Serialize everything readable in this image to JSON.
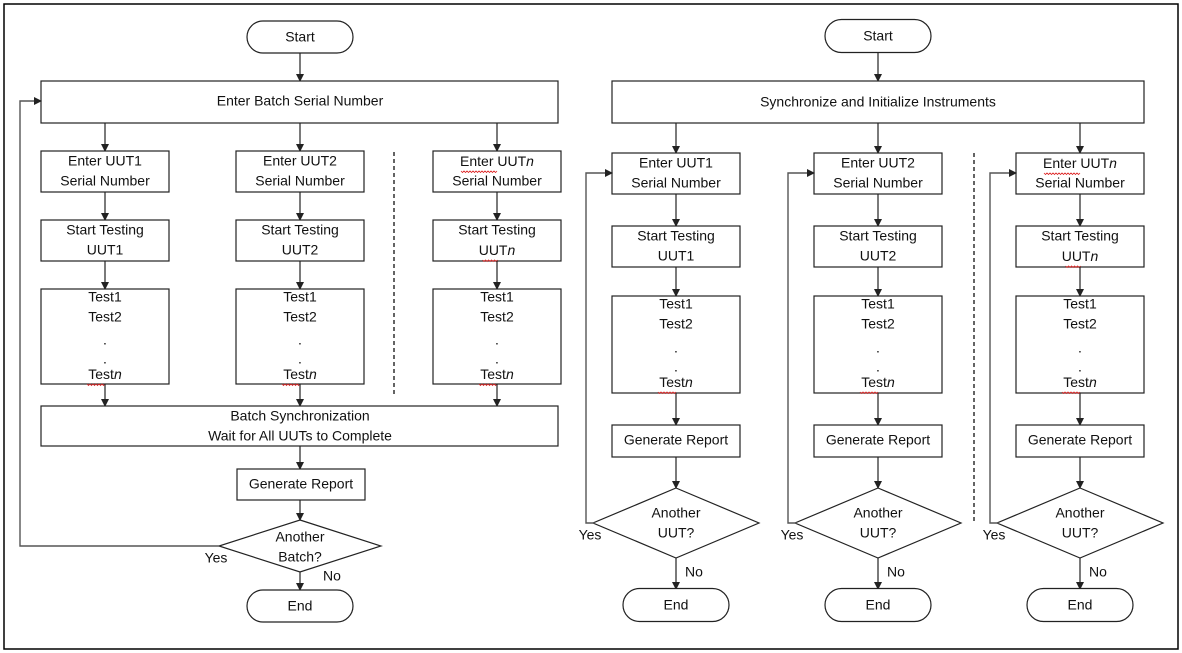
{
  "diagram": {
    "left": {
      "start": "Start",
      "batch_serial": "Enter Batch Serial Number",
      "columns": [
        {
          "enter": [
            "Enter UUT1",
            "Serial Number"
          ],
          "start_testing": [
            "Start Testing",
            "UUT1"
          ],
          "tests": [
            "Test1",
            "Test2",
            ".",
            ".",
            "Testn"
          ]
        },
        {
          "enter": [
            "Enter UUT2",
            "Serial Number"
          ],
          "start_testing": [
            "Start Testing",
            "UUT2"
          ],
          "tests": [
            "Test1",
            "Test2",
            ".",
            ".",
            "Testn"
          ]
        },
        {
          "enter": [
            "Enter UUTn",
            "Serial Number"
          ],
          "start_testing": [
            "Start Testing",
            "UUTn"
          ],
          "tests": [
            "Test1",
            "Test2",
            ".",
            ".",
            "Testn"
          ]
        }
      ],
      "sync": [
        "Batch Synchronization",
        "Wait for All UUTs to Complete"
      ],
      "report": "Generate Report",
      "decision": [
        "Another",
        "Batch?"
      ],
      "yes": "Yes",
      "no": "No",
      "end": "End"
    },
    "right": {
      "start": "Start",
      "init": "Synchronize and Initialize Instruments",
      "columns": [
        {
          "enter": [
            "Enter UUT1",
            "Serial Number"
          ],
          "start_testing": [
            "Start Testing",
            "UUT1"
          ],
          "tests": [
            "Test1",
            "Test2",
            ".",
            ".",
            "Testn"
          ],
          "report": "Generate Report",
          "decision": [
            "Another",
            "UUT?"
          ],
          "yes": "Yes",
          "no": "No",
          "end": "End"
        },
        {
          "enter": [
            "Enter UUT2",
            "Serial Number"
          ],
          "start_testing": [
            "Start Testing",
            "UUT2"
          ],
          "tests": [
            "Test1",
            "Test2",
            ".",
            ".",
            "Testn"
          ],
          "report": "Generate Report",
          "decision": [
            "Another",
            "UUT?"
          ],
          "yes": "Yes",
          "no": "No",
          "end": "End"
        },
        {
          "enter": [
            "Enter UUTn",
            "Serial Number"
          ],
          "start_testing": [
            "Start Testing",
            "UUTn"
          ],
          "tests": [
            "Test1",
            "Test2",
            ".",
            ".",
            "Testn"
          ],
          "report": "Generate Report",
          "decision": [
            "Another",
            "UUT?"
          ],
          "yes": "Yes",
          "no": "No",
          "end": "End"
        }
      ]
    }
  }
}
